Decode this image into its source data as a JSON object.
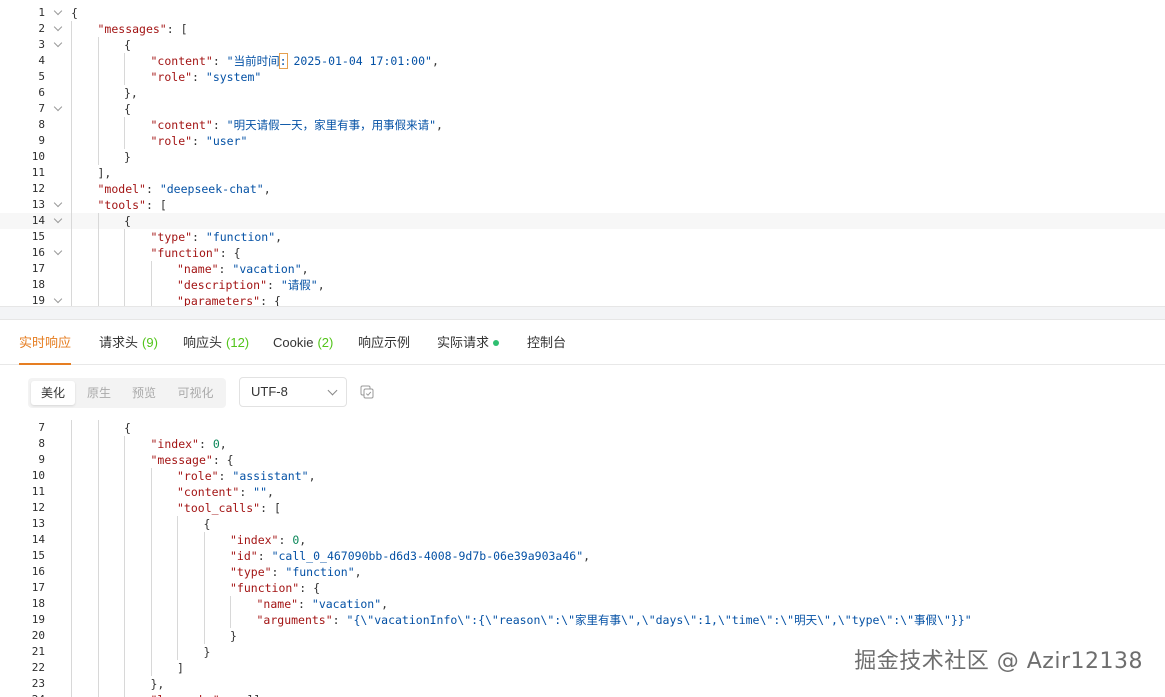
{
  "request_editor": {
    "lines": [
      {
        "n": "1",
        "fold": true,
        "depth": 0,
        "html": "<span class='p'>{</span>"
      },
      {
        "n": "2",
        "fold": true,
        "depth": 1,
        "html": "<span class='k'>\"messages\"</span><span class='p'>: [</span>"
      },
      {
        "n": "3",
        "fold": true,
        "depth": 2,
        "html": "<span class='p'>{</span>"
      },
      {
        "n": "4",
        "fold": false,
        "depth": 3,
        "html": "<span class='k'>\"content\"</span><span class='p'>: </span><span class='s'>\"当前时间<span class='cursor-box'>:</span> 2025-01-04 17:01:00\"</span><span class='p'>,</span>"
      },
      {
        "n": "5",
        "fold": false,
        "depth": 3,
        "html": "<span class='k'>\"role\"</span><span class='p'>: </span><span class='s'>\"system\"</span>"
      },
      {
        "n": "6",
        "fold": false,
        "depth": 2,
        "html": "<span class='p'>},</span>"
      },
      {
        "n": "7",
        "fold": true,
        "depth": 2,
        "html": "<span class='p'>{</span>"
      },
      {
        "n": "8",
        "fold": false,
        "depth": 3,
        "html": "<span class='k'>\"content\"</span><span class='p'>: </span><span class='s'>\"明天请假一天，家里有事，用事假来请\"</span><span class='p'>,</span>"
      },
      {
        "n": "9",
        "fold": false,
        "depth": 3,
        "html": "<span class='k'>\"role\"</span><span class='p'>: </span><span class='s'>\"user\"</span>"
      },
      {
        "n": "10",
        "fold": false,
        "depth": 2,
        "html": "<span class='p'>}</span>"
      },
      {
        "n": "11",
        "fold": false,
        "depth": 1,
        "html": "<span class='p'>],</span>"
      },
      {
        "n": "12",
        "fold": false,
        "depth": 1,
        "html": "<span class='k'>\"model\"</span><span class='p'>: </span><span class='s'>\"deepseek-chat\"</span><span class='p'>,</span>"
      },
      {
        "n": "13",
        "fold": true,
        "depth": 1,
        "html": "<span class='k'>\"tools\"</span><span class='p'>: [</span>"
      },
      {
        "n": "14",
        "fold": true,
        "depth": 2,
        "active": true,
        "html": "<span class='p'>{</span>"
      },
      {
        "n": "15",
        "fold": false,
        "depth": 3,
        "html": "<span class='k'>\"type\"</span><span class='p'>: </span><span class='s'>\"function\"</span><span class='p'>,</span>"
      },
      {
        "n": "16",
        "fold": true,
        "depth": 3,
        "html": "<span class='k'>\"function\"</span><span class='p'>: {</span>"
      },
      {
        "n": "17",
        "fold": false,
        "depth": 4,
        "html": "<span class='k'>\"name\"</span><span class='p'>: </span><span class='s'>\"vacation\"</span><span class='p'>,</span>"
      },
      {
        "n": "18",
        "fold": false,
        "depth": 4,
        "html": "<span class='k'>\"description\"</span><span class='p'>: </span><span class='s'>\"请假\"</span><span class='p'>,</span>"
      },
      {
        "n": "19",
        "fold": true,
        "depth": 4,
        "html": "<span class='k'>\"parameters\"</span><span class='p'>: {</span>"
      }
    ]
  },
  "tabs": [
    {
      "label": "实时响应",
      "count": "",
      "active": true,
      "dot": false
    },
    {
      "label": "请求头",
      "count": "(9)",
      "active": false,
      "dot": false
    },
    {
      "label": "响应头",
      "count": "(12)",
      "active": false,
      "dot": false
    },
    {
      "label": "Cookie",
      "count": "(2)",
      "active": false,
      "dot": false
    },
    {
      "label": "响应示例",
      "count": "",
      "active": false,
      "dot": false
    },
    {
      "label": "实际请求",
      "count": "",
      "active": false,
      "dot": true
    },
    {
      "label": "控制台",
      "count": "",
      "active": false,
      "dot": false
    }
  ],
  "toolbar": {
    "modes": [
      "美化",
      "原生",
      "预览",
      "可视化"
    ],
    "active_mode": "美化",
    "encoding": "UTF-8"
  },
  "response_editor": {
    "lines": [
      {
        "n": "7",
        "depth": 2,
        "html": "<span class='p'>{</span>"
      },
      {
        "n": "8",
        "depth": 3,
        "html": "<span class='k'>\"index\"</span><span class='p'>: </span><span class='n'>0</span><span class='p'>,</span>"
      },
      {
        "n": "9",
        "depth": 3,
        "html": "<span class='k'>\"message\"</span><span class='p'>: {</span>"
      },
      {
        "n": "10",
        "depth": 4,
        "html": "<span class='k'>\"role\"</span><span class='p'>: </span><span class='s'>\"assistant\"</span><span class='p'>,</span>"
      },
      {
        "n": "11",
        "depth": 4,
        "html": "<span class='k'>\"content\"</span><span class='p'>: </span><span class='s'>\"\"</span><span class='p'>,</span>"
      },
      {
        "n": "12",
        "depth": 4,
        "html": "<span class='k'>\"tool_calls\"</span><span class='p'>: [</span>"
      },
      {
        "n": "13",
        "depth": 5,
        "html": "<span class='p'>{</span>"
      },
      {
        "n": "14",
        "depth": 6,
        "html": "<span class='k'>\"index\"</span><span class='p'>: </span><span class='n'>0</span><span class='p'>,</span>"
      },
      {
        "n": "15",
        "depth": 6,
        "html": "<span class='k'>\"id\"</span><span class='p'>: </span><span class='s'>\"call_0_467090bb-d6d3-4008-9d7b-06e39a903a46\"</span><span class='p'>,</span>"
      },
      {
        "n": "16",
        "depth": 6,
        "html": "<span class='k'>\"type\"</span><span class='p'>: </span><span class='s'>\"function\"</span><span class='p'>,</span>"
      },
      {
        "n": "17",
        "depth": 6,
        "html": "<span class='k'>\"function\"</span><span class='p'>: {</span>"
      },
      {
        "n": "18",
        "depth": 7,
        "html": "<span class='k'>\"name\"</span><span class='p'>: </span><span class='s'>\"vacation\"</span><span class='p'>,</span>"
      },
      {
        "n": "19",
        "depth": 7,
        "html": "<span class='k'>\"arguments\"</span><span class='p'>: </span><span class='s'>\"{\\\"vacationInfo\\\":{\\\"reason\\\":\\\"家里有事\\\",\\\"days\\\":1,\\\"time\\\":\\\"明天\\\",\\\"type\\\":\\\"事假\\\"}}\"</span>"
      },
      {
        "n": "20",
        "depth": 6,
        "html": "<span class='p'>}</span>"
      },
      {
        "n": "21",
        "depth": 5,
        "html": "<span class='p'>}</span>"
      },
      {
        "n": "22",
        "depth": 4,
        "html": "<span class='p'>]</span>"
      },
      {
        "n": "23",
        "depth": 3,
        "html": "<span class='p'>},</span>"
      },
      {
        "n": "24",
        "depth": 3,
        "html": "<span class='k'>\"logprobs\"</span><span class='p'>: null,</span>"
      }
    ]
  },
  "watermark": "掘金技术社区 @ Azir12138",
  "colors": {
    "accent": "#e67e22",
    "count": "#52c41a",
    "dot": "#2fbf71",
    "key": "#a31515",
    "string": "#0451a5",
    "number": "#098658"
  }
}
